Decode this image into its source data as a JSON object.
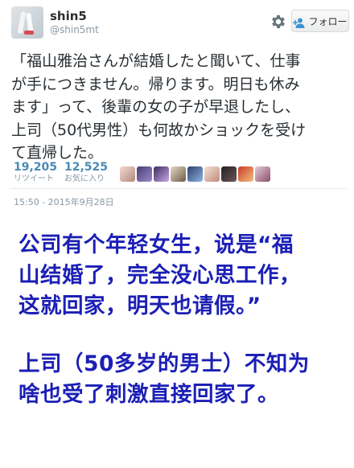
{
  "user": {
    "name": "shin5",
    "handle": "@shin5mt"
  },
  "follow_button": {
    "label": "フォロー"
  },
  "tweet": {
    "lines": [
      "「福山雅治さんが結婚したと聞いて、仕事",
      "が手につきません。帰ります。明日も休み",
      "ます」って、後輩の女の子が早退したし、",
      "上司（50代男性）も何故かショックを受け",
      "て直帰した。"
    ]
  },
  "stats": {
    "retweets": {
      "count": "19,205",
      "label": "リツイート"
    },
    "likes": {
      "count": "12,525",
      "label": "お気に入り"
    }
  },
  "timestamp": "15:50 - 2015年9月28日",
  "translation": {
    "paragraph1": [
      "公司有个年轻女生，说是“福",
      "山结婚了，完全没心思工作，",
      "这就回家，明天也请假。”"
    ],
    "paragraph2": [
      "上司（50多岁的男士）不知为",
      "啥也受了刺激直接回家了。"
    ]
  },
  "colors": {
    "translation_text": "#1b1fb5",
    "stat_number": "#4a8ab3",
    "muted_text": "#8899a6",
    "follow_icon": "#3b94d9"
  },
  "icons": {
    "gear": "gear-icon",
    "follow": "follow-user-icon"
  }
}
